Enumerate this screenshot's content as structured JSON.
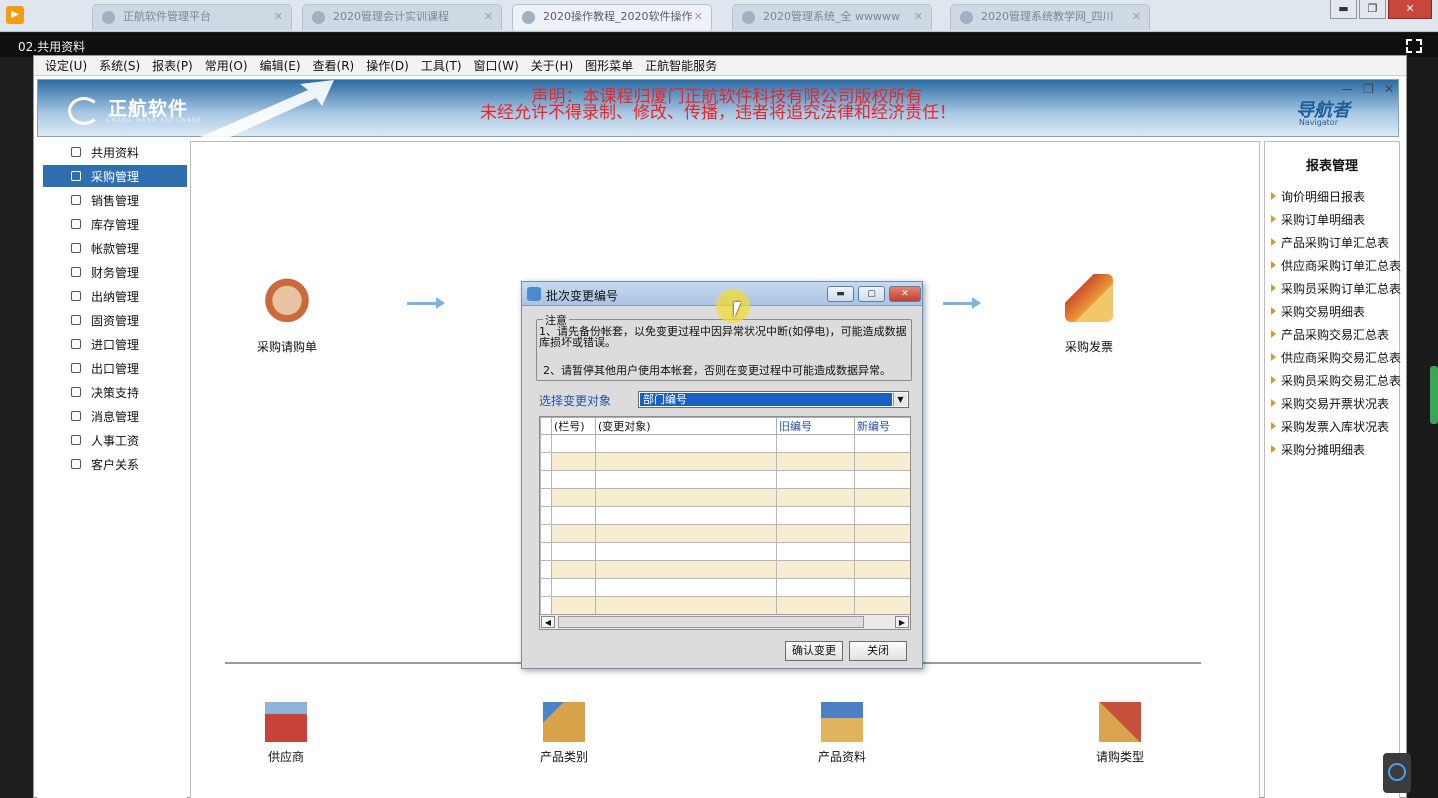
{
  "browser_tabs": [
    {
      "label": "正航软件管理平台"
    },
    {
      "label": "2020管理会计实训课程"
    },
    {
      "label": "2020操作教程_2020软件操作"
    },
    {
      "label": "2020管理系统_全 wwwww"
    },
    {
      "label": "2020管理系统教学网_四川"
    }
  ],
  "player": {
    "title": "02.共用资料"
  },
  "window_controls": {
    "minimize": "▬",
    "maximize": "❐",
    "close": "✕"
  },
  "menubar": [
    "设定(U)",
    "系统(S)",
    "报表(P)",
    "常用(O)",
    "编辑(E)",
    "查看(R)",
    "操作(D)",
    "工具(T)",
    "窗口(W)",
    "关于(H)",
    "图形菜单",
    "正航智能服务"
  ],
  "banner": {
    "brand": "正航软件",
    "brand_sub": "CHANG HANG SOFTWARE",
    "declaration_line1": "声明：本课程归厦门正航软件科技有限公司版权所有",
    "declaration_line2": "未经允许不得录制、修改、传播，违者将追究法律和经济责任！",
    "navigator": "导航者",
    "navigator_sub": "Navigator"
  },
  "sidebar": {
    "items": [
      {
        "label": "共用资料",
        "icon": "table-icon"
      },
      {
        "label": "采购管理",
        "icon": "cart-icon",
        "active": true
      },
      {
        "label": "销售管理",
        "icon": "sales-icon"
      },
      {
        "label": "库存管理",
        "icon": "warehouse-icon"
      },
      {
        "label": "帐款管理",
        "icon": "ledger-icon"
      },
      {
        "label": "财务管理",
        "icon": "finance-icon"
      },
      {
        "label": "出纳管理",
        "icon": "yen-icon"
      },
      {
        "label": "固资管理",
        "icon": "asset-icon"
      },
      {
        "label": "进口管理",
        "icon": "import-icon"
      },
      {
        "label": "出口管理",
        "icon": "export-icon"
      },
      {
        "label": "决策支持",
        "icon": "decision-icon"
      },
      {
        "label": "消息管理",
        "icon": "chart-icon"
      },
      {
        "label": "人事工资",
        "icon": "hr-icon"
      },
      {
        "label": "客户关系",
        "icon": "customer-icon"
      }
    ]
  },
  "flow": {
    "nodes": [
      {
        "label": "采购请购单",
        "color": "#c9693c"
      },
      {
        "label": "采购发票",
        "color": "#d34b2a"
      }
    ],
    "base_nodes": [
      {
        "label": "供应商",
        "color": "#c7423a"
      },
      {
        "label": "产品类别",
        "color": "#d7a24a"
      },
      {
        "label": "产品资料",
        "color": "#4b80c4"
      },
      {
        "label": "请购类型",
        "color": "#d9a44d"
      }
    ]
  },
  "report_panel": {
    "title": "报表管理",
    "items": [
      "询价明细日报表",
      "采购订单明细表",
      "产品采购订单汇总表",
      "供应商采购订单汇总表",
      "采购员采购订单汇总表",
      "采购交易明细表",
      "产品采购交易汇总表",
      "供应商采购交易汇总表",
      "采购员采购交易汇总表",
      "采购交易开票状况表",
      "采购发票入库状况表",
      "采购分摊明细表"
    ]
  },
  "dialog": {
    "title": "批次变更编号",
    "notice_legend": "注意",
    "notice_1": "1、请先备份帐套，以免变更过程中因异常状况中断(如停电)，可能造成数据库损坏或错误。",
    "notice_2": "2、请暂停其他用户使用本帐套，否则在变更过程中可能造成数据异常。",
    "select_label": "选择变更对象",
    "select_value": "部门编号",
    "grid": {
      "columns": [
        "(栏号)",
        "(变更对象)",
        "旧编号",
        "新编号"
      ],
      "rows": [
        [
          "",
          "",
          "",
          ""
        ],
        [
          "",
          "",
          "",
          ""
        ],
        [
          "",
          "",
          "",
          ""
        ],
        [
          "",
          "",
          "",
          ""
        ],
        [
          "",
          "",
          "",
          ""
        ],
        [
          "",
          "",
          "",
          ""
        ],
        [
          "",
          "",
          "",
          ""
        ],
        [
          "",
          "",
          "",
          ""
        ],
        [
          "",
          "",
          "",
          ""
        ],
        [
          "",
          "",
          "",
          ""
        ]
      ]
    },
    "confirm_label": "确认变更",
    "close_label": "关闭"
  },
  "colors": {
    "accent": "#2e6fb0",
    "declaration": "#e8262a",
    "row_alt": "#f8ecd1"
  }
}
